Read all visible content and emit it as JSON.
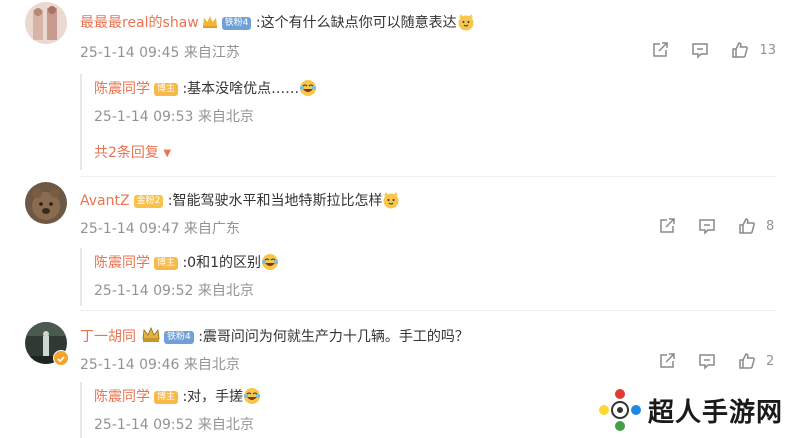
{
  "comments": [
    {
      "user": "最最最real的shaw",
      "badge": "铁粉4",
      "text": ":这个有什么缺点你可以随意表达",
      "time": "25-1-14 09:45",
      "location": "来自江苏",
      "likes": "13",
      "reply": {
        "user": "陈震同学",
        "badge": "博主",
        "text": ":基本没啥优点……",
        "time": "25-1-14 09:53",
        "location": "来自北京"
      },
      "more_replies": "共2条回复"
    },
    {
      "user": "AvantZ",
      "badge": "金粉2",
      "text": ":智能驾驶水平和当地特斯拉比怎样",
      "time": "25-1-14 09:47",
      "location": "来自广东",
      "likes": "8",
      "reply": {
        "user": "陈震同学",
        "badge": "博主",
        "text": ":0和1的区别",
        "time": "25-1-14 09:52",
        "location": "来自北京"
      }
    },
    {
      "user": "丁一胡同",
      "badge": "铁粉4",
      "text": ":震哥问问为何就生产力十几辆。手工的吗？",
      "time": "25-1-14 09:46",
      "location": "来自北京",
      "likes": "2",
      "reply": {
        "user": "陈震同学",
        "badge": "博主",
        "text": ":对，手搓",
        "time": "25-1-14 09:52",
        "location": "来自北京"
      }
    }
  ],
  "watermark": "超人手游网",
  "colors": {
    "username": "#eb7350",
    "meta": "#939393",
    "text": "#333333"
  },
  "icons": [
    "share-icon",
    "comment-icon",
    "like-icon",
    "laugh-emoji-icon",
    "cat-emoji-icon",
    "crown-icon"
  ]
}
